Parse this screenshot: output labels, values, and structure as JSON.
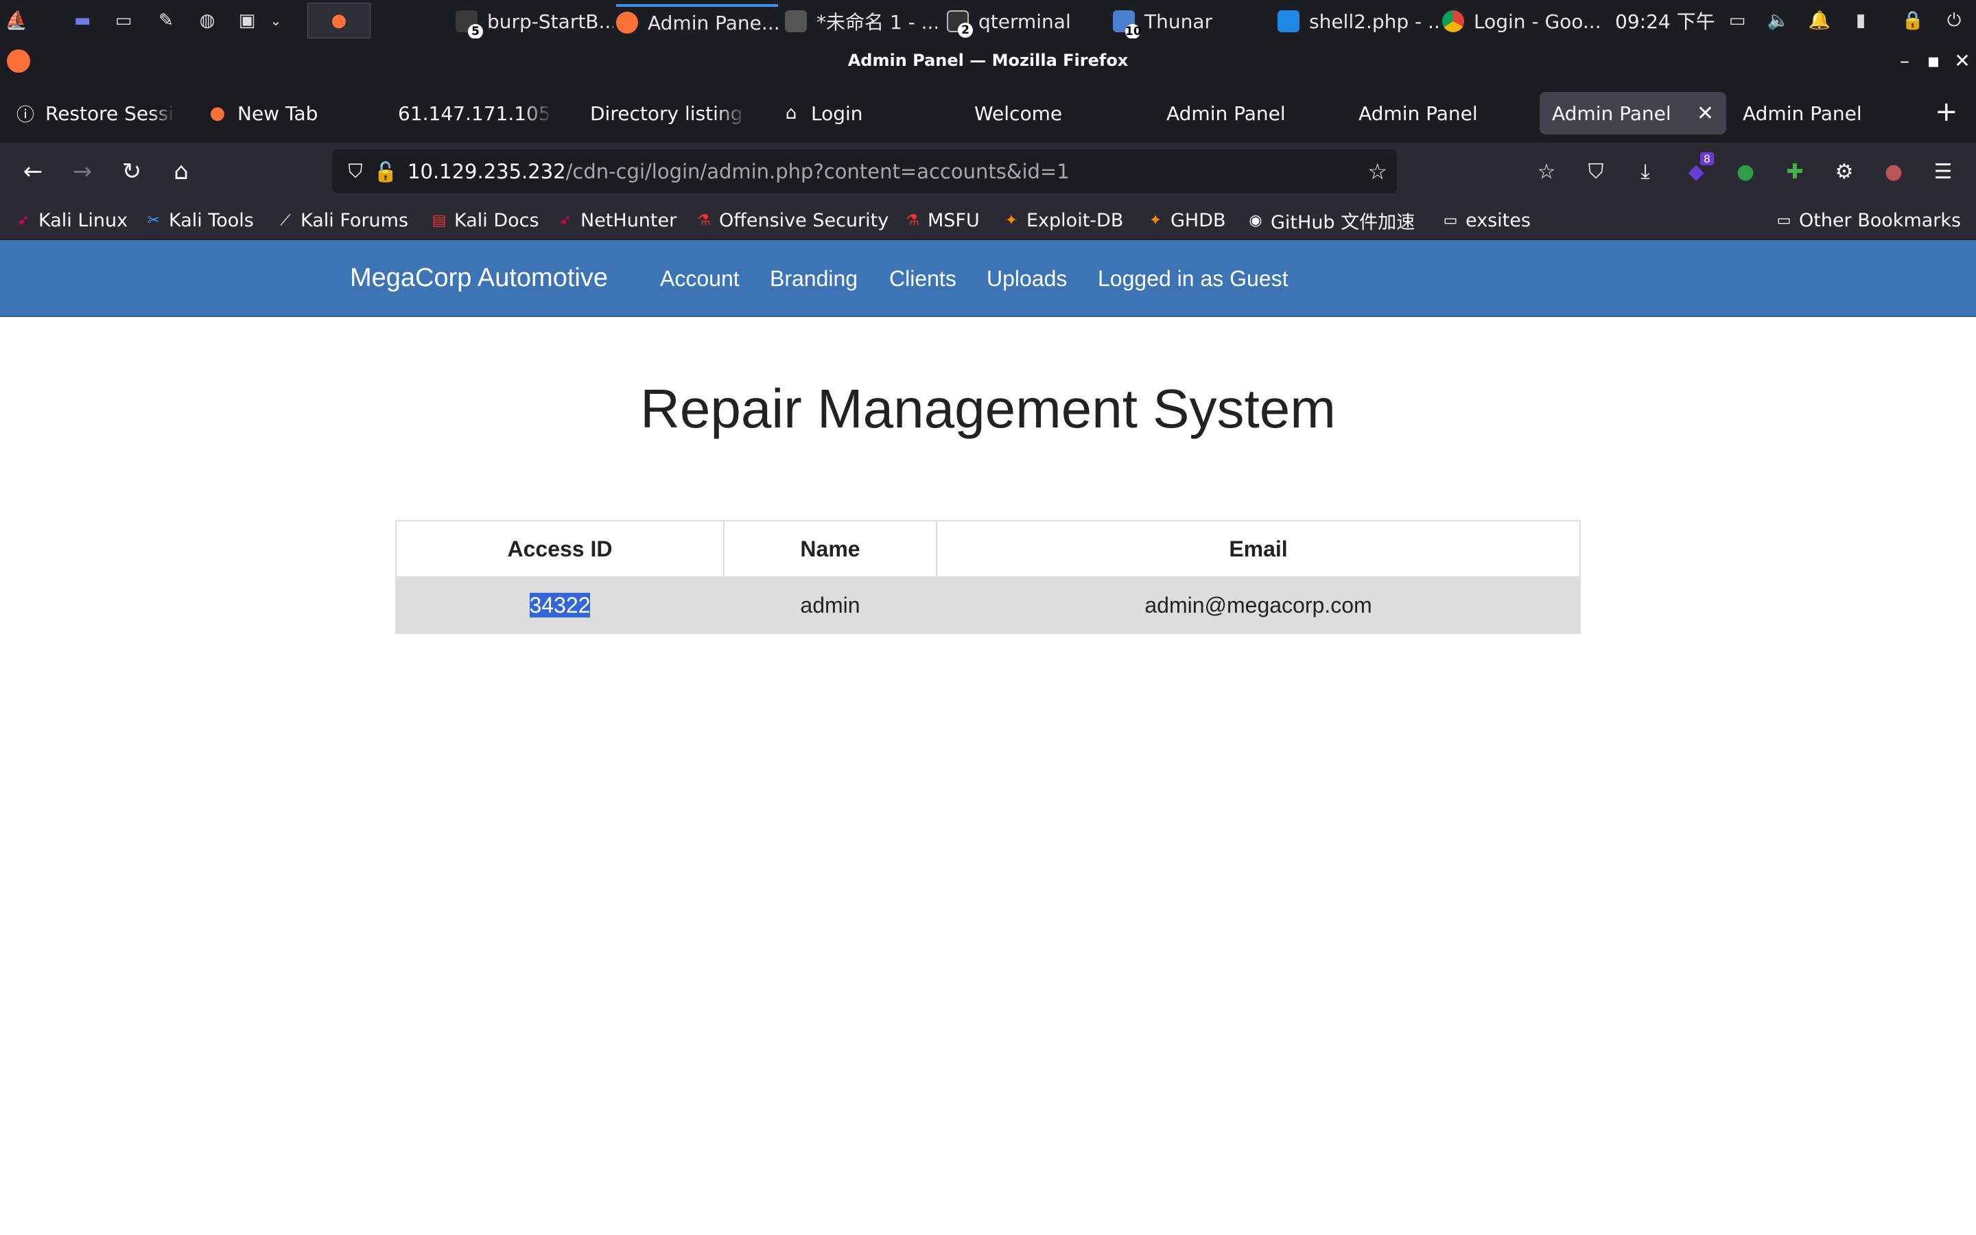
{
  "taskbar": {
    "tasks": [
      {
        "label": "burp-StartB...",
        "count": "5"
      },
      {
        "label": "Admin Pane..."
      },
      {
        "label": "*未命名 1 - ..."
      },
      {
        "label": "qterminal",
        "count": "2"
      },
      {
        "label": "Thunar",
        "count": "10"
      },
      {
        "label": "shell2.php - ..."
      },
      {
        "label": "Login - Goo..."
      }
    ],
    "clock": "09:24 下午"
  },
  "window": {
    "title": "Admin Panel — Mozilla Firefox"
  },
  "tabs": [
    {
      "label": "Restore Session"
    },
    {
      "label": "New Tab"
    },
    {
      "label": "61.147.171.105:54"
    },
    {
      "label": "Directory listing for"
    },
    {
      "label": "Login"
    },
    {
      "label": "Welcome"
    },
    {
      "label": "Admin Panel"
    },
    {
      "label": "Admin Panel"
    },
    {
      "label": "Admin Panel"
    },
    {
      "label": "Admin Panel"
    }
  ],
  "urlbar": {
    "host": "10.129.235.232",
    "path": "/cdn-cgi/login/admin.php?content=accounts&id=1"
  },
  "extensions": {
    "badge": "8"
  },
  "bookmarks": [
    {
      "label": "Kali Linux"
    },
    {
      "label": "Kali Tools"
    },
    {
      "label": "Kali Forums"
    },
    {
      "label": "Kali Docs"
    },
    {
      "label": "NetHunter"
    },
    {
      "label": "Offensive Security"
    },
    {
      "label": "MSFU"
    },
    {
      "label": "Exploit-DB"
    },
    {
      "label": "GHDB"
    },
    {
      "label": "GitHub 文件加速"
    },
    {
      "label": "exsites"
    }
  ],
  "other_bookmarks": "Other Bookmarks",
  "site": {
    "brand": "MegaCorp Automotive",
    "nav": [
      "Account",
      "Branding",
      "Clients",
      "Uploads",
      "Logged in as Guest"
    ],
    "heading": "Repair Management System",
    "table": {
      "headers": [
        "Access ID",
        "Name",
        "Email"
      ],
      "rows": [
        [
          "34322",
          "admin",
          "admin@megacorp.com"
        ]
      ]
    }
  },
  "colors": {
    "site_nav": "#3d74b6",
    "browser_chrome": "#2b2a33",
    "selection": "#3367d6"
  }
}
